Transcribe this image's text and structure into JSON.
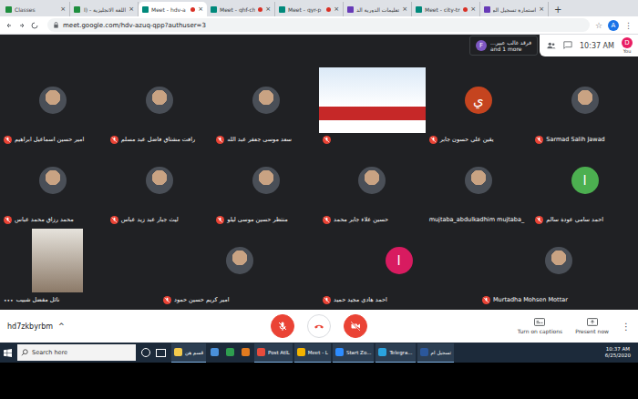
{
  "browser": {
    "tabs": [
      {
        "label": "Classes",
        "selected": false,
        "recording": false,
        "color": "#1e8e3e"
      },
      {
        "label": "اللغة الانجليزية - (I",
        "selected": false,
        "recording": false,
        "color": "#1e8e3e"
      },
      {
        "label": "Meet - hdv-a",
        "selected": true,
        "recording": true,
        "color": "#00897b"
      },
      {
        "label": "Meet - qhf-ch",
        "selected": false,
        "recording": true,
        "color": "#00897b"
      },
      {
        "label": "Meet - qyr-p",
        "selected": false,
        "recording": true,
        "color": "#00897b"
      },
      {
        "label": "تعليمات الدورية الد",
        "selected": false,
        "recording": false,
        "color": "#673ab7"
      },
      {
        "label": "Meet - city-tr",
        "selected": false,
        "recording": true,
        "color": "#00897b"
      },
      {
        "label": "استمارة تسجيل الم",
        "selected": false,
        "recording": false,
        "color": "#673ab7"
      }
    ],
    "close": "×",
    "new_tab": "+",
    "address": "meet.google.com/hdv-azuq-qpp?authuser=3",
    "profile": "A",
    "menu": "⋮"
  },
  "header": {
    "presenter_avatar": "F",
    "presenter_name": "فرقد غالب عبير...",
    "presenter_more": "and 1 more",
    "time": "10:37 AM",
    "you_label": "You",
    "you_avatar": "D"
  },
  "rows": [
    {
      "tiles": [
        {
          "kind": "photo",
          "name": "امير حسين اسماعيل ابراهيم",
          "muted": true
        },
        {
          "kind": "photo",
          "name": "رافت مشتاق فاضل عبد مسلم",
          "muted": true
        },
        {
          "kind": "photo",
          "name": "سعد موسى جعفر عبد الله",
          "muted": true
        },
        {
          "kind": "video",
          "muted": true
        },
        {
          "kind": "letter",
          "letter": "ي",
          "color": "#c5441f",
          "name": "يقين علي حسون جابر",
          "muted": true
        },
        {
          "kind": "photo",
          "name": "Sarmad Salih Jawad",
          "muted": true
        }
      ]
    },
    {
      "tiles": [
        {
          "kind": "photo",
          "name": "محمد رزاق محمد عباس",
          "muted": true
        },
        {
          "kind": "photo",
          "name": "ليث جبار عبد زيد عباس",
          "muted": true
        },
        {
          "kind": "photo",
          "name": "منتظر حسين موسى ليلو",
          "muted": true
        },
        {
          "kind": "photo",
          "name": "حسين علاء جابر محمد",
          "muted": true
        },
        {
          "kind": "photo",
          "name": "mujtaba_abdulkadhim mujtaba_",
          "muted": false
        },
        {
          "kind": "letter",
          "letter": "ا",
          "color": "#4caf50",
          "name": "احمد سامي عودة سالم",
          "muted": true
        }
      ]
    },
    {
      "tiles": [
        {
          "kind": "video",
          "name": "نائل مفضل شبيب",
          "muted": false,
          "options": "•••"
        },
        {
          "kind": "photo",
          "name": "امير كريم حسين حمود",
          "muted": true
        },
        {
          "kind": "letter",
          "letter": "ا",
          "color": "#d81b60",
          "name": "احمد هادي مجيد حميد",
          "muted": true
        },
        {
          "kind": "photo",
          "name": "Murtadha Mohsen Mottar",
          "muted": true
        }
      ]
    }
  ],
  "bottom_bar": {
    "meeting_code": "hd7zkbyrbm",
    "caret": "^",
    "controls": [
      {
        "kind": "mic",
        "on": false
      },
      {
        "kind": "hangup",
        "on": true
      },
      {
        "kind": "camera",
        "on": false
      }
    ],
    "actions": [
      {
        "kind": "captions",
        "label": "Turn on captions"
      },
      {
        "kind": "present",
        "label": "Present now"
      }
    ],
    "more": "⋮"
  },
  "taskbar": {
    "search": "Search here",
    "apps": [
      {
        "label": "قسم هن",
        "color": "#f2c94c"
      },
      {
        "label": "",
        "color": "#4a90d9"
      },
      {
        "label": "",
        "color": "#2e9e4f"
      },
      {
        "label": "",
        "color": "#e07a1f"
      },
      {
        "label": "Post AtlL",
        "color": "#e74c3c"
      },
      {
        "label": "Meet - L",
        "color": "#f4b400"
      },
      {
        "label": "Start Zo...",
        "color": "#2d8cff"
      },
      {
        "label": "Telegra...",
        "color": "#2aa3de"
      },
      {
        "label": "تسجيل ام",
        "color": "#2b579a"
      }
    ],
    "time": "10:37 AM",
    "date": "6/25/2020"
  }
}
